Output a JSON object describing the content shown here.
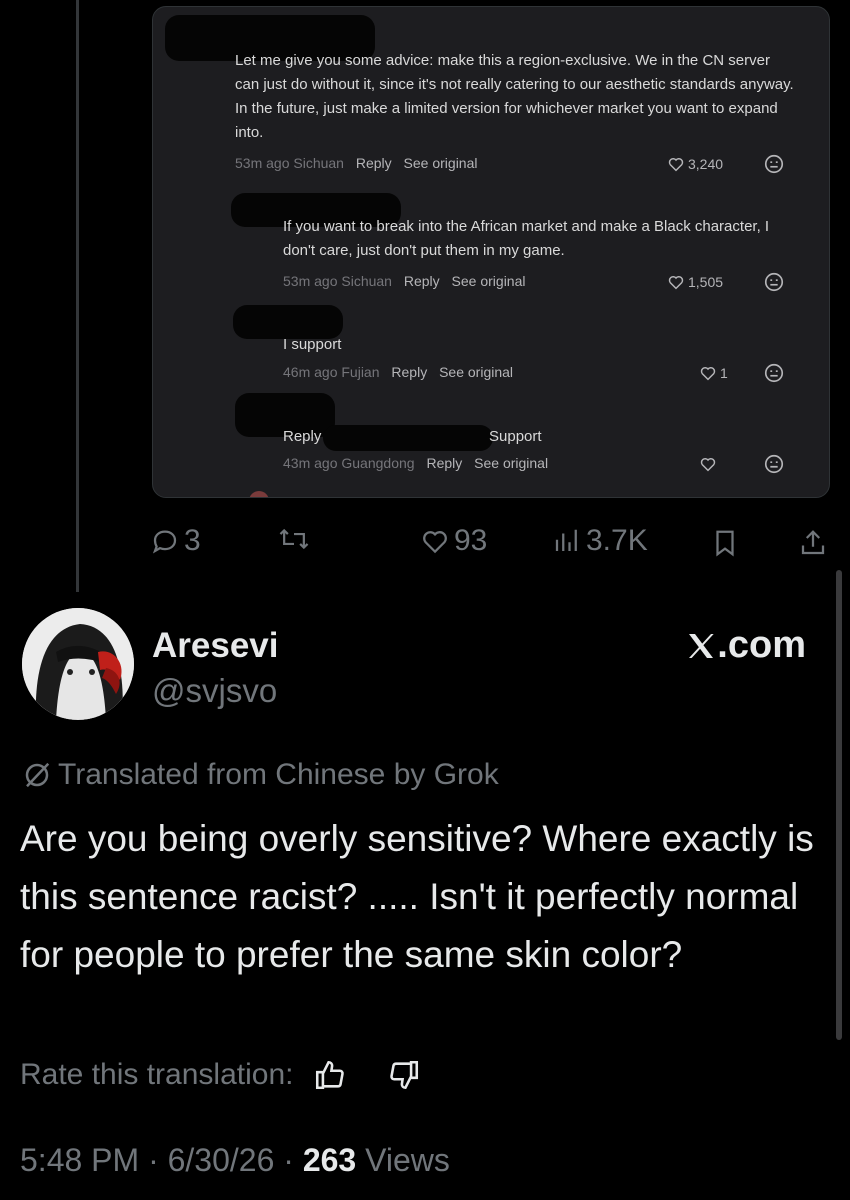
{
  "comments": [
    {
      "text": "Let me give you some advice: make this a region-exclusive. We in the CN server can just do without it, since it's not really catering to our aesthetic standards anyway. In the future, just make a limited version for whichever market you want to expand into.",
      "time": "53m ago",
      "location": "Sichuan",
      "reply_label": "Reply",
      "see_original_label": "See original",
      "likes": "3,240"
    },
    {
      "text": "If you want to break into the African market and make a Black character, I don't care, just don't put them in my game.",
      "time": "53m ago",
      "location": "Sichuan",
      "reply_label": "Reply",
      "see_original_label": "See original",
      "likes": "1,505"
    },
    {
      "text": "I support",
      "time": "46m ago",
      "location": "Fujian",
      "reply_label": "Reply",
      "see_original_label": "See original",
      "likes": "1"
    },
    {
      "text_prefix": "Reply",
      "text_suffix": "Support",
      "time": "43m ago",
      "location": "Guangdong",
      "reply_label": "Reply",
      "see_original_label": "See original",
      "likes": ""
    }
  ],
  "parent_actions": {
    "replies": "3",
    "reposts": "",
    "likes": "93",
    "views": "3.7K"
  },
  "tweet": {
    "author_name": "Aresevi",
    "author_handle": "@svjsvo",
    "site_label": ".com",
    "translated_label": "Translated from Chinese by Grok",
    "text": "Are you being overly sensitive? Where exactly is this sentence racist? ..... Isn't it perfectly normal for people to prefer the same skin color?",
    "rate_label": "Rate this translation:",
    "time": "5:48 PM",
    "date": "6/30/26",
    "views_count": "263",
    "views_label": "Views"
  },
  "colors": {
    "background": "#000000",
    "text_primary": "#e7e9ea",
    "text_secondary": "#71767b",
    "embed_bg": "#1d1d20"
  },
  "icons": [
    "reply-icon",
    "repost-icon",
    "heart-icon",
    "views-icon",
    "bookmark-icon",
    "share-icon",
    "x-logo-icon",
    "translate-icon",
    "thumbs-up-icon",
    "thumbs-down-icon",
    "emoji-icon"
  ]
}
